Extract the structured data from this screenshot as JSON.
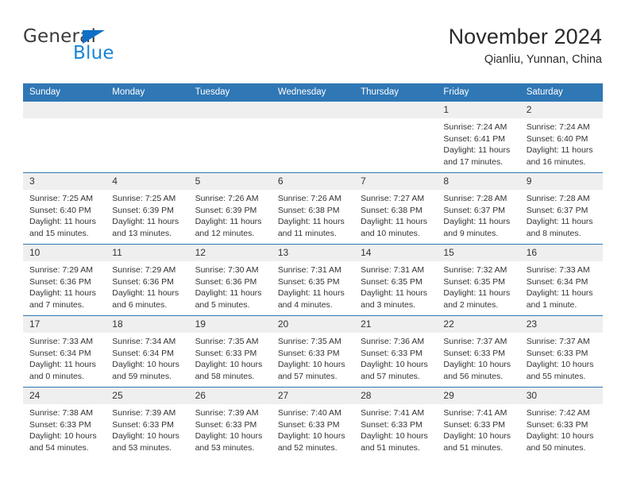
{
  "brand": {
    "name_part1": "General",
    "name_part2": "Blue",
    "triangle_icon": "triangle-icon",
    "accent_color": "#1884d6"
  },
  "header": {
    "title": "November 2024",
    "subtitle": "Qianliu, Yunnan, China"
  },
  "calendar": {
    "header_bg": "#3077b5",
    "daynum_bg": "#efefef",
    "weekday_labels": [
      "Sunday",
      "Monday",
      "Tuesday",
      "Wednesday",
      "Thursday",
      "Friday",
      "Saturday"
    ],
    "weeks": [
      [
        {
          "day": "",
          "lines": []
        },
        {
          "day": "",
          "lines": []
        },
        {
          "day": "",
          "lines": []
        },
        {
          "day": "",
          "lines": []
        },
        {
          "day": "",
          "lines": []
        },
        {
          "day": "1",
          "lines": [
            "Sunrise: 7:24 AM",
            "Sunset: 6:41 PM",
            "Daylight: 11 hours and 17 minutes."
          ]
        },
        {
          "day": "2",
          "lines": [
            "Sunrise: 7:24 AM",
            "Sunset: 6:40 PM",
            "Daylight: 11 hours and 16 minutes."
          ]
        }
      ],
      [
        {
          "day": "3",
          "lines": [
            "Sunrise: 7:25 AM",
            "Sunset: 6:40 PM",
            "Daylight: 11 hours and 15 minutes."
          ]
        },
        {
          "day": "4",
          "lines": [
            "Sunrise: 7:25 AM",
            "Sunset: 6:39 PM",
            "Daylight: 11 hours and 13 minutes."
          ]
        },
        {
          "day": "5",
          "lines": [
            "Sunrise: 7:26 AM",
            "Sunset: 6:39 PM",
            "Daylight: 11 hours and 12 minutes."
          ]
        },
        {
          "day": "6",
          "lines": [
            "Sunrise: 7:26 AM",
            "Sunset: 6:38 PM",
            "Daylight: 11 hours and 11 minutes."
          ]
        },
        {
          "day": "7",
          "lines": [
            "Sunrise: 7:27 AM",
            "Sunset: 6:38 PM",
            "Daylight: 11 hours and 10 minutes."
          ]
        },
        {
          "day": "8",
          "lines": [
            "Sunrise: 7:28 AM",
            "Sunset: 6:37 PM",
            "Daylight: 11 hours and 9 minutes."
          ]
        },
        {
          "day": "9",
          "lines": [
            "Sunrise: 7:28 AM",
            "Sunset: 6:37 PM",
            "Daylight: 11 hours and 8 minutes."
          ]
        }
      ],
      [
        {
          "day": "10",
          "lines": [
            "Sunrise: 7:29 AM",
            "Sunset: 6:36 PM",
            "Daylight: 11 hours and 7 minutes."
          ]
        },
        {
          "day": "11",
          "lines": [
            "Sunrise: 7:29 AM",
            "Sunset: 6:36 PM",
            "Daylight: 11 hours and 6 minutes."
          ]
        },
        {
          "day": "12",
          "lines": [
            "Sunrise: 7:30 AM",
            "Sunset: 6:36 PM",
            "Daylight: 11 hours and 5 minutes."
          ]
        },
        {
          "day": "13",
          "lines": [
            "Sunrise: 7:31 AM",
            "Sunset: 6:35 PM",
            "Daylight: 11 hours and 4 minutes."
          ]
        },
        {
          "day": "14",
          "lines": [
            "Sunrise: 7:31 AM",
            "Sunset: 6:35 PM",
            "Daylight: 11 hours and 3 minutes."
          ]
        },
        {
          "day": "15",
          "lines": [
            "Sunrise: 7:32 AM",
            "Sunset: 6:35 PM",
            "Daylight: 11 hours and 2 minutes."
          ]
        },
        {
          "day": "16",
          "lines": [
            "Sunrise: 7:33 AM",
            "Sunset: 6:34 PM",
            "Daylight: 11 hours and 1 minute."
          ]
        }
      ],
      [
        {
          "day": "17",
          "lines": [
            "Sunrise: 7:33 AM",
            "Sunset: 6:34 PM",
            "Daylight: 11 hours and 0 minutes."
          ]
        },
        {
          "day": "18",
          "lines": [
            "Sunrise: 7:34 AM",
            "Sunset: 6:34 PM",
            "Daylight: 10 hours and 59 minutes."
          ]
        },
        {
          "day": "19",
          "lines": [
            "Sunrise: 7:35 AM",
            "Sunset: 6:33 PM",
            "Daylight: 10 hours and 58 minutes."
          ]
        },
        {
          "day": "20",
          "lines": [
            "Sunrise: 7:35 AM",
            "Sunset: 6:33 PM",
            "Daylight: 10 hours and 57 minutes."
          ]
        },
        {
          "day": "21",
          "lines": [
            "Sunrise: 7:36 AM",
            "Sunset: 6:33 PM",
            "Daylight: 10 hours and 57 minutes."
          ]
        },
        {
          "day": "22",
          "lines": [
            "Sunrise: 7:37 AM",
            "Sunset: 6:33 PM",
            "Daylight: 10 hours and 56 minutes."
          ]
        },
        {
          "day": "23",
          "lines": [
            "Sunrise: 7:37 AM",
            "Sunset: 6:33 PM",
            "Daylight: 10 hours and 55 minutes."
          ]
        }
      ],
      [
        {
          "day": "24",
          "lines": [
            "Sunrise: 7:38 AM",
            "Sunset: 6:33 PM",
            "Daylight: 10 hours and 54 minutes."
          ]
        },
        {
          "day": "25",
          "lines": [
            "Sunrise: 7:39 AM",
            "Sunset: 6:33 PM",
            "Daylight: 10 hours and 53 minutes."
          ]
        },
        {
          "day": "26",
          "lines": [
            "Sunrise: 7:39 AM",
            "Sunset: 6:33 PM",
            "Daylight: 10 hours and 53 minutes."
          ]
        },
        {
          "day": "27",
          "lines": [
            "Sunrise: 7:40 AM",
            "Sunset: 6:33 PM",
            "Daylight: 10 hours and 52 minutes."
          ]
        },
        {
          "day": "28",
          "lines": [
            "Sunrise: 7:41 AM",
            "Sunset: 6:33 PM",
            "Daylight: 10 hours and 51 minutes."
          ]
        },
        {
          "day": "29",
          "lines": [
            "Sunrise: 7:41 AM",
            "Sunset: 6:33 PM",
            "Daylight: 10 hours and 51 minutes."
          ]
        },
        {
          "day": "30",
          "lines": [
            "Sunrise: 7:42 AM",
            "Sunset: 6:33 PM",
            "Daylight: 10 hours and 50 minutes."
          ]
        }
      ]
    ]
  }
}
